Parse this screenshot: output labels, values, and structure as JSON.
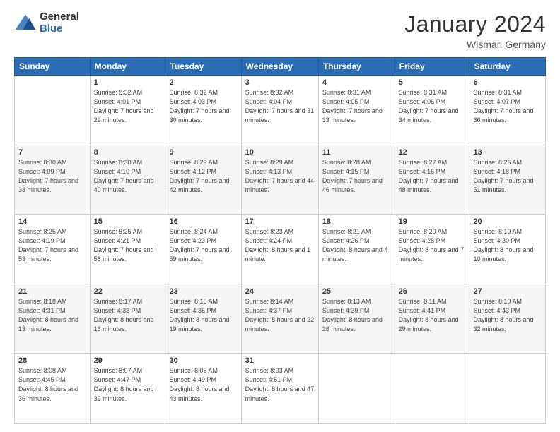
{
  "logo": {
    "general": "General",
    "blue": "Blue"
  },
  "header": {
    "month": "January 2024",
    "location": "Wismar, Germany"
  },
  "weekdays": [
    "Sunday",
    "Monday",
    "Tuesday",
    "Wednesday",
    "Thursday",
    "Friday",
    "Saturday"
  ],
  "weeks": [
    [
      {
        "day": "",
        "sunrise": "",
        "sunset": "",
        "daylight": ""
      },
      {
        "day": "1",
        "sunrise": "Sunrise: 8:32 AM",
        "sunset": "Sunset: 4:01 PM",
        "daylight": "Daylight: 7 hours and 29 minutes."
      },
      {
        "day": "2",
        "sunrise": "Sunrise: 8:32 AM",
        "sunset": "Sunset: 4:03 PM",
        "daylight": "Daylight: 7 hours and 30 minutes."
      },
      {
        "day": "3",
        "sunrise": "Sunrise: 8:32 AM",
        "sunset": "Sunset: 4:04 PM",
        "daylight": "Daylight: 7 hours and 31 minutes."
      },
      {
        "day": "4",
        "sunrise": "Sunrise: 8:31 AM",
        "sunset": "Sunset: 4:05 PM",
        "daylight": "Daylight: 7 hours and 33 minutes."
      },
      {
        "day": "5",
        "sunrise": "Sunrise: 8:31 AM",
        "sunset": "Sunset: 4:06 PM",
        "daylight": "Daylight: 7 hours and 34 minutes."
      },
      {
        "day": "6",
        "sunrise": "Sunrise: 8:31 AM",
        "sunset": "Sunset: 4:07 PM",
        "daylight": "Daylight: 7 hours and 36 minutes."
      }
    ],
    [
      {
        "day": "7",
        "sunrise": "Sunrise: 8:30 AM",
        "sunset": "Sunset: 4:09 PM",
        "daylight": "Daylight: 7 hours and 38 minutes."
      },
      {
        "day": "8",
        "sunrise": "Sunrise: 8:30 AM",
        "sunset": "Sunset: 4:10 PM",
        "daylight": "Daylight: 7 hours and 40 minutes."
      },
      {
        "day": "9",
        "sunrise": "Sunrise: 8:29 AM",
        "sunset": "Sunset: 4:12 PM",
        "daylight": "Daylight: 7 hours and 42 minutes."
      },
      {
        "day": "10",
        "sunrise": "Sunrise: 8:29 AM",
        "sunset": "Sunset: 4:13 PM",
        "daylight": "Daylight: 7 hours and 44 minutes."
      },
      {
        "day": "11",
        "sunrise": "Sunrise: 8:28 AM",
        "sunset": "Sunset: 4:15 PM",
        "daylight": "Daylight: 7 hours and 46 minutes."
      },
      {
        "day": "12",
        "sunrise": "Sunrise: 8:27 AM",
        "sunset": "Sunset: 4:16 PM",
        "daylight": "Daylight: 7 hours and 48 minutes."
      },
      {
        "day": "13",
        "sunrise": "Sunrise: 8:26 AM",
        "sunset": "Sunset: 4:18 PM",
        "daylight": "Daylight: 7 hours and 51 minutes."
      }
    ],
    [
      {
        "day": "14",
        "sunrise": "Sunrise: 8:25 AM",
        "sunset": "Sunset: 4:19 PM",
        "daylight": "Daylight: 7 hours and 53 minutes."
      },
      {
        "day": "15",
        "sunrise": "Sunrise: 8:25 AM",
        "sunset": "Sunset: 4:21 PM",
        "daylight": "Daylight: 7 hours and 56 minutes."
      },
      {
        "day": "16",
        "sunrise": "Sunrise: 8:24 AM",
        "sunset": "Sunset: 4:23 PM",
        "daylight": "Daylight: 7 hours and 59 minutes."
      },
      {
        "day": "17",
        "sunrise": "Sunrise: 8:23 AM",
        "sunset": "Sunset: 4:24 PM",
        "daylight": "Daylight: 8 hours and 1 minute."
      },
      {
        "day": "18",
        "sunrise": "Sunrise: 8:21 AM",
        "sunset": "Sunset: 4:26 PM",
        "daylight": "Daylight: 8 hours and 4 minutes."
      },
      {
        "day": "19",
        "sunrise": "Sunrise: 8:20 AM",
        "sunset": "Sunset: 4:28 PM",
        "daylight": "Daylight: 8 hours and 7 minutes."
      },
      {
        "day": "20",
        "sunrise": "Sunrise: 8:19 AM",
        "sunset": "Sunset: 4:30 PM",
        "daylight": "Daylight: 8 hours and 10 minutes."
      }
    ],
    [
      {
        "day": "21",
        "sunrise": "Sunrise: 8:18 AM",
        "sunset": "Sunset: 4:31 PM",
        "daylight": "Daylight: 8 hours and 13 minutes."
      },
      {
        "day": "22",
        "sunrise": "Sunrise: 8:17 AM",
        "sunset": "Sunset: 4:33 PM",
        "daylight": "Daylight: 8 hours and 16 minutes."
      },
      {
        "day": "23",
        "sunrise": "Sunrise: 8:15 AM",
        "sunset": "Sunset: 4:35 PM",
        "daylight": "Daylight: 8 hours and 19 minutes."
      },
      {
        "day": "24",
        "sunrise": "Sunrise: 8:14 AM",
        "sunset": "Sunset: 4:37 PM",
        "daylight": "Daylight: 8 hours and 22 minutes."
      },
      {
        "day": "25",
        "sunrise": "Sunrise: 8:13 AM",
        "sunset": "Sunset: 4:39 PM",
        "daylight": "Daylight: 8 hours and 26 minutes."
      },
      {
        "day": "26",
        "sunrise": "Sunrise: 8:11 AM",
        "sunset": "Sunset: 4:41 PM",
        "daylight": "Daylight: 8 hours and 29 minutes."
      },
      {
        "day": "27",
        "sunrise": "Sunrise: 8:10 AM",
        "sunset": "Sunset: 4:43 PM",
        "daylight": "Daylight: 8 hours and 32 minutes."
      }
    ],
    [
      {
        "day": "28",
        "sunrise": "Sunrise: 8:08 AM",
        "sunset": "Sunset: 4:45 PM",
        "daylight": "Daylight: 8 hours and 36 minutes."
      },
      {
        "day": "29",
        "sunrise": "Sunrise: 8:07 AM",
        "sunset": "Sunset: 4:47 PM",
        "daylight": "Daylight: 8 hours and 39 minutes."
      },
      {
        "day": "30",
        "sunrise": "Sunrise: 8:05 AM",
        "sunset": "Sunset: 4:49 PM",
        "daylight": "Daylight: 8 hours and 43 minutes."
      },
      {
        "day": "31",
        "sunrise": "Sunrise: 8:03 AM",
        "sunset": "Sunset: 4:51 PM",
        "daylight": "Daylight: 8 hours and 47 minutes."
      },
      {
        "day": "",
        "sunrise": "",
        "sunset": "",
        "daylight": ""
      },
      {
        "day": "",
        "sunrise": "",
        "sunset": "",
        "daylight": ""
      },
      {
        "day": "",
        "sunrise": "",
        "sunset": "",
        "daylight": ""
      }
    ]
  ]
}
